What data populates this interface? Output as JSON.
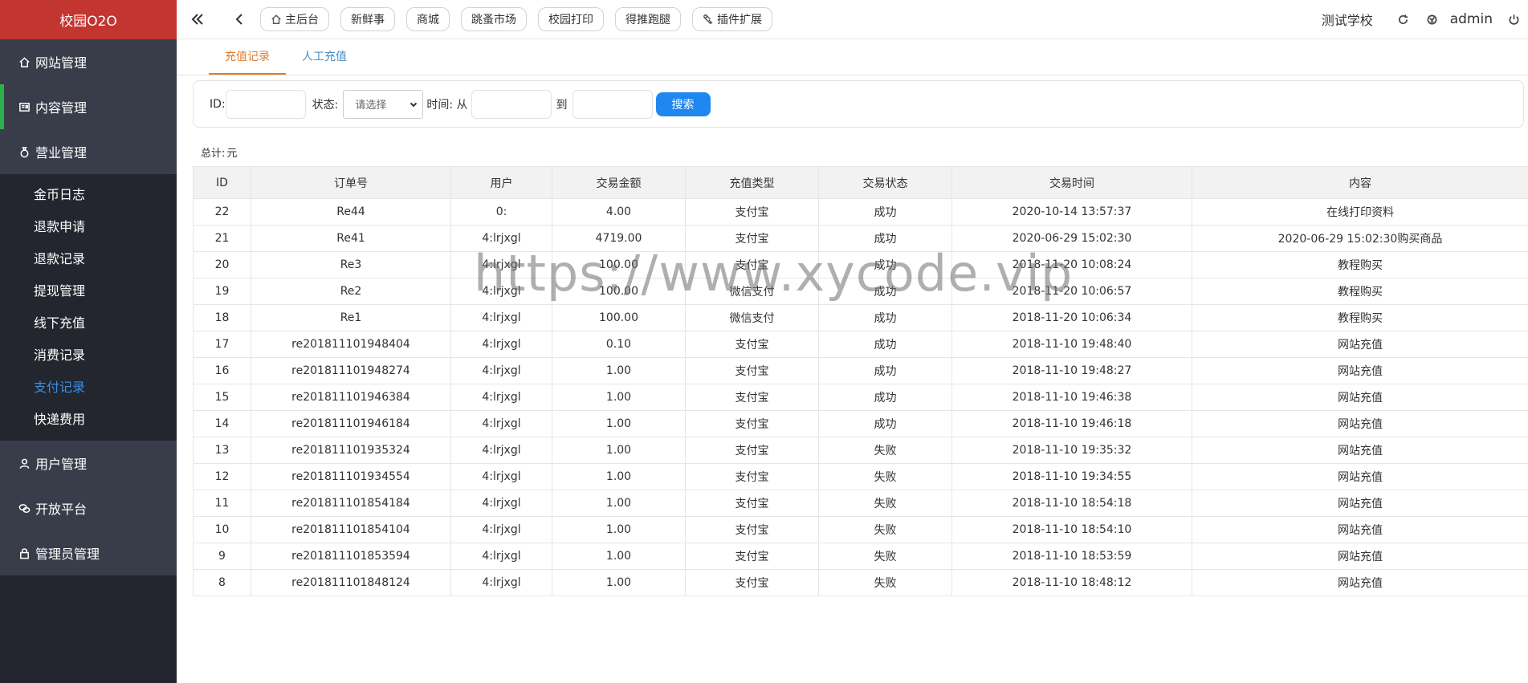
{
  "brand": "校园O2O",
  "sidebar": {
    "top_items": [
      {
        "label": "网站管理",
        "icon": "home-icon"
      },
      {
        "label": "内容管理",
        "icon": "content-icon"
      },
      {
        "label": "营业管理",
        "icon": "business-icon"
      }
    ],
    "sub_items": [
      {
        "label": "金币日志"
      },
      {
        "label": "退款申请"
      },
      {
        "label": "退款记录"
      },
      {
        "label": "提现管理"
      },
      {
        "label": "线下充值"
      },
      {
        "label": "消费记录"
      },
      {
        "label": "支付记录",
        "current": true
      },
      {
        "label": "快递费用"
      }
    ],
    "bottom_items": [
      {
        "label": "用户管理",
        "icon": "user-icon"
      },
      {
        "label": "开放平台",
        "icon": "chat-icon"
      },
      {
        "label": "管理员管理",
        "icon": "lock-icon"
      }
    ]
  },
  "topbar": {
    "tabs": [
      {
        "label": "主后台",
        "icon": "home-icon"
      },
      {
        "label": "新鲜事"
      },
      {
        "label": "商城"
      },
      {
        "label": "跳蚤市场"
      },
      {
        "label": "校园打印"
      },
      {
        "label": "得推跑腿"
      },
      {
        "label": "插件扩展",
        "icon": "plugin-icon"
      }
    ],
    "school": "测试学校",
    "user": "admin"
  },
  "subtabs": [
    {
      "label": "充值记录",
      "active": true
    },
    {
      "label": "人工充值"
    }
  ],
  "search": {
    "id_label": "ID:",
    "status_label": "状态:",
    "status_value": "请选择",
    "time_label": "时间: 从",
    "to_label": "到",
    "button": "搜索"
  },
  "total": {
    "label": "总计:",
    "value": "元"
  },
  "table": {
    "headers": [
      "ID",
      "订单号",
      "用户",
      "交易金额",
      "充值类型",
      "交易状态",
      "交易时间",
      "内容"
    ],
    "rows": [
      [
        "22",
        "Re44",
        "0:",
        "4.00",
        "支付宝",
        "成功",
        "2020-10-14 13:57:37",
        "在线打印资料"
      ],
      [
        "21",
        "Re41",
        "4:lrjxgl",
        "4719.00",
        "支付宝",
        "成功",
        "2020-06-29 15:02:30",
        "2020-06-29 15:02:30购买商品"
      ],
      [
        "20",
        "Re3",
        "4:lrjxgl",
        "100.00",
        "支付宝",
        "成功",
        "2018-11-20 10:08:24",
        "教程购买"
      ],
      [
        "19",
        "Re2",
        "4:lrjxgl",
        "100.00",
        "微信支付",
        "成功",
        "2018-11-20 10:06:57",
        "教程购买"
      ],
      [
        "18",
        "Re1",
        "4:lrjxgl",
        "100.00",
        "微信支付",
        "成功",
        "2018-11-20 10:06:34",
        "教程购买"
      ],
      [
        "17",
        "re201811101948404",
        "4:lrjxgl",
        "0.10",
        "支付宝",
        "成功",
        "2018-11-10 19:48:40",
        "网站充值"
      ],
      [
        "16",
        "re201811101948274",
        "4:lrjxgl",
        "1.00",
        "支付宝",
        "成功",
        "2018-11-10 19:48:27",
        "网站充值"
      ],
      [
        "15",
        "re201811101946384",
        "4:lrjxgl",
        "1.00",
        "支付宝",
        "成功",
        "2018-11-10 19:46:38",
        "网站充值"
      ],
      [
        "14",
        "re201811101946184",
        "4:lrjxgl",
        "1.00",
        "支付宝",
        "成功",
        "2018-11-10 19:46:18",
        "网站充值"
      ],
      [
        "13",
        "re201811101935324",
        "4:lrjxgl",
        "1.00",
        "支付宝",
        "失败",
        "2018-11-10 19:35:32",
        "网站充值"
      ],
      [
        "12",
        "re201811101934554",
        "4:lrjxgl",
        "1.00",
        "支付宝",
        "失败",
        "2018-11-10 19:34:55",
        "网站充值"
      ],
      [
        "11",
        "re201811101854184",
        "4:lrjxgl",
        "1.00",
        "支付宝",
        "失败",
        "2018-11-10 18:54:18",
        "网站充值"
      ],
      [
        "10",
        "re201811101854104",
        "4:lrjxgl",
        "1.00",
        "支付宝",
        "失败",
        "2018-11-10 18:54:10",
        "网站充值"
      ],
      [
        "9",
        "re201811101853594",
        "4:lrjxgl",
        "1.00",
        "支付宝",
        "失败",
        "2018-11-10 18:53:59",
        "网站充值"
      ],
      [
        "8",
        "re201811101848124",
        "4:lrjxgl",
        "1.00",
        "支付宝",
        "失败",
        "2018-11-10 18:48:12",
        "网站充值"
      ]
    ]
  },
  "watermark": "https://www.xycode.vip",
  "colors": {
    "brand": "#c23531",
    "sidebar": "#23262e",
    "accent": "#1e87f0",
    "active_tab": "#e07b2f",
    "nav_bar": "#2bb24c"
  }
}
